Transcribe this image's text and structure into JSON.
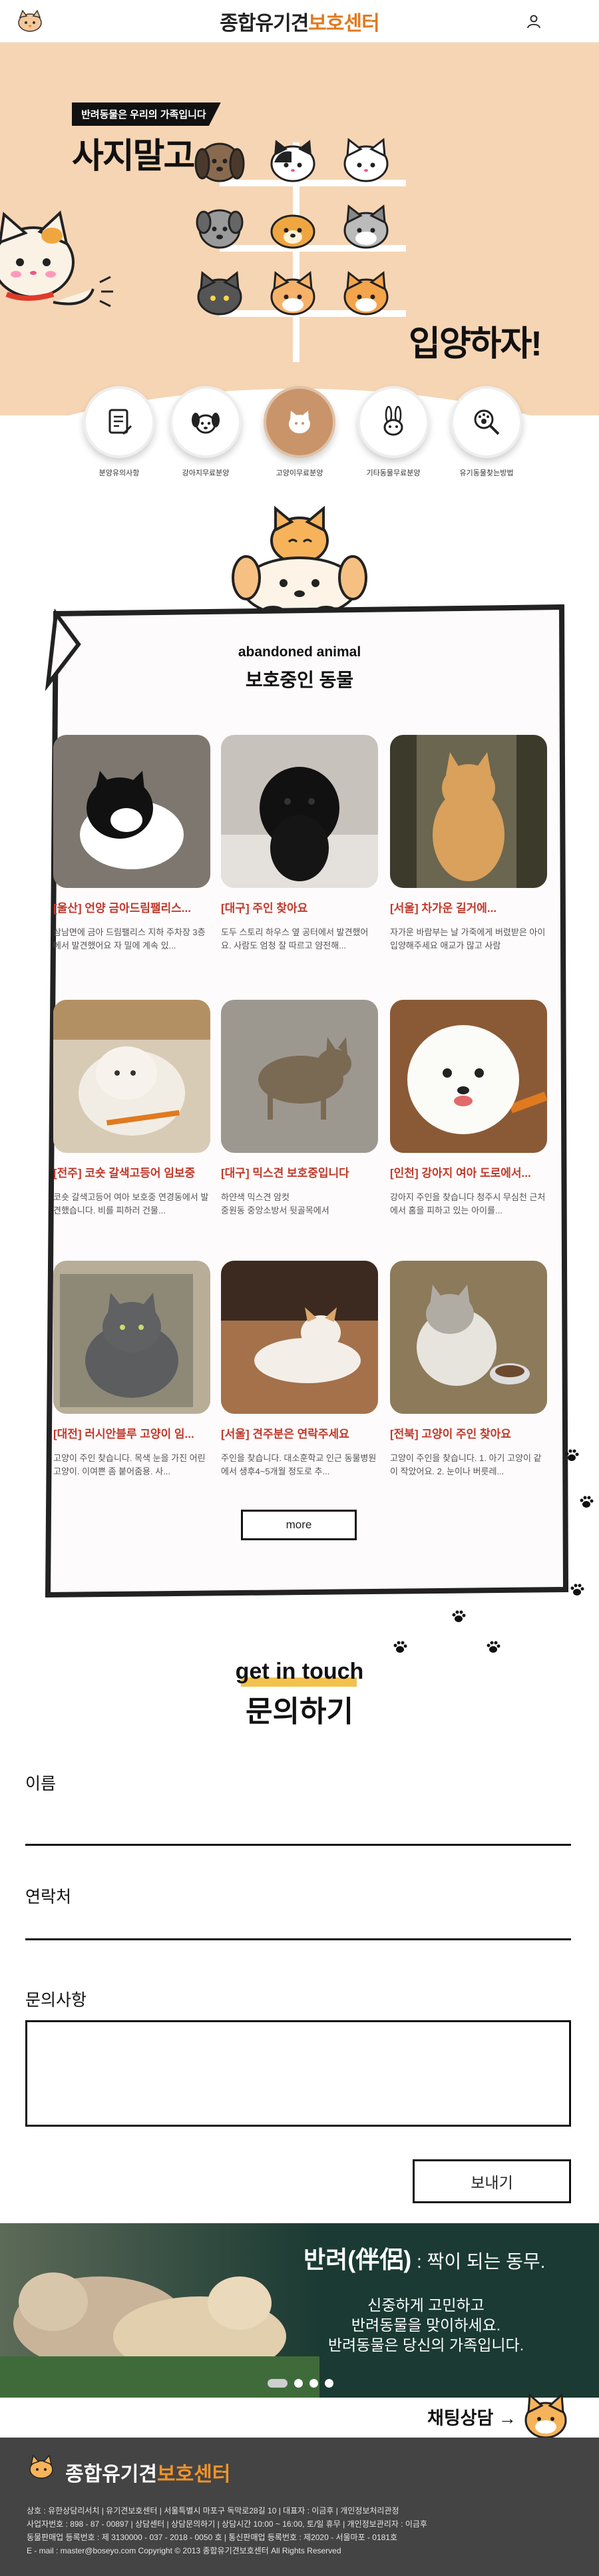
{
  "header": {
    "title_part1": "종합유기견",
    "title_part2": "보호센터"
  },
  "hero": {
    "tag": "반려동물은 우리의 가족입니다",
    "headline_left": "사지말고",
    "headline_right": "입양하자!"
  },
  "categories": [
    {
      "label": "분양유의사항",
      "icon": "document-icon"
    },
    {
      "label": "강아지무료분양",
      "icon": "dog-icon"
    },
    {
      "label": "고양이무료분양",
      "icon": "cat-icon"
    },
    {
      "label": "기타동물무료분양",
      "icon": "rabbit-icon"
    },
    {
      "label": "유기동물찾는방법",
      "icon": "magnifier-paw-icon"
    }
  ],
  "board": {
    "title_en": "abandoned animal",
    "title_ko": "보호중인 동물",
    "more": "more",
    "cards": [
      {
        "title": "[울산] 언양 금아드림팰리스...",
        "desc": "삼남면에 금아 드림팰리스 지하 주차장 3층에서 발견했어요 자 밀에 계속 있..."
      },
      {
        "title": "[대구] 주인 찾아요",
        "desc": "도두 스토리 하우스 옆 공터에서 발견했어요. 사람도 엄청 잘 따르고 얌전해..."
      },
      {
        "title": "[서울] 차가운 길거에...",
        "desc": "자가운 바람부는 날 가죽에게 버렸받은 아이 입양해주세요 애교가 많고 사람"
      },
      {
        "title": "[전주] 코숏 갈색고등어 임보중",
        "desc": "코숏 갈색고등어 여아 보호중 연경동에서 발견했습니다. 비를 피하러 건물..."
      },
      {
        "title": "[대구] 믹스견 보호중입니다",
        "desc": "하얀색 믹스견 암컷\n중원동 중앙소방서 뒷골목에서"
      },
      {
        "title": "[인천] 강아지 여아 도로에서...",
        "desc": "강아지 주인을 찾습니다 청주시 무심천 근처에서 홈을 피하고 있는 아이를..."
      },
      {
        "title": "[대전] 러시안블루 고양이 임...",
        "desc": "고양이 주인 찾습니다. 목색 눈을 가진 어린 고양이. 이여쁜 좀 붙어줌용. 사..."
      },
      {
        "title": "[서울] 견주분은 연락주세요",
        "desc": "주인을 찾습니다. 대소훈학교 인근 동물병원에서 생후4~5개월 정도로 추..."
      },
      {
        "title": "[전북] 고양이 주인 찾아요",
        "desc": "고양이 주인을 찾습니다. 1. 아기 고양이 같이 작았어요. 2. 눈이나 버릇레..."
      }
    ]
  },
  "contact": {
    "title_en": "get in touch",
    "title_ko": "문의하기",
    "name_label": "이름",
    "phone_label": "연락처",
    "inquiry_label": "문의사항",
    "send": "보내기"
  },
  "banner": {
    "title": "반려(伴侶)",
    "title_sub": " : 짝이 되는 동무.",
    "line1": "신중하게 고민하고",
    "line2": "반려동물을 맞이하세요.",
    "line3": "반려동물은 당신의 가족입니다.",
    "slides_total": 4,
    "active_slide": 1
  },
  "chat": {
    "label": "채팅상담 →"
  },
  "footer": {
    "title_part1": "종합유기견",
    "title_part2": "보호센터",
    "line1": "상호 : 유한상담리서치 | 유기견보호센터 | 서울특별시 마포구 독막로28길 10 | 대표자 : 이금후 | 개인정보처리관정",
    "line2": "사업자번호 : 898 - 87 - 00897 | 상담센터 | 상담문의하기 | 상담시간 10:00 ~ 16:00, 토/일 휴무 | 개인정보관리자 : 이금후",
    "line3": "동물판매업 등록번호 : 제 3130000 - 037 - 2018 - 0050 호 | 통신판매업 등록번호 : 제2020 - 서울마포 - 0181호",
    "line4": "E - mail : master@boseyo.com Copyright © 2013 종합유기견보호센터 All Rights Reserved"
  },
  "colors": {
    "accent": "#e07a1f",
    "hero_bg": "#f6d5b4",
    "title_red": "#c0392b",
    "banner_bg": "#1a3a33",
    "footer_bg": "#444444"
  }
}
